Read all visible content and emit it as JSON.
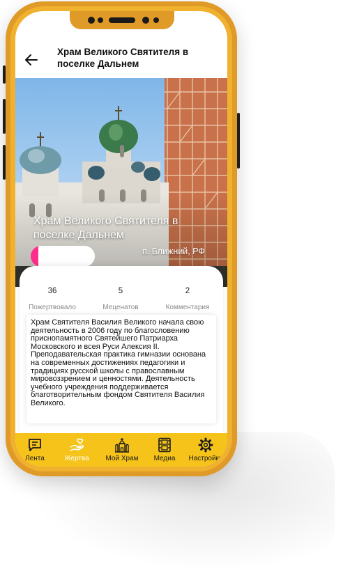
{
  "appbar": {
    "title": "Храм Великого Святителя в поселке Дальнем"
  },
  "hero": {
    "title": "Храм Великого Святителя в поселке Дальнем",
    "location": "п. Ближний, РФ",
    "progress_fraction": 0.12,
    "progress_color": "#ff2d8b"
  },
  "stats": [
    {
      "value": "36",
      "label": "Пожертвовало"
    },
    {
      "value": "5",
      "label": "Меценатов"
    },
    {
      "value": "2",
      "label": "Комментария"
    }
  ],
  "description": "Храм Святителя Василия Великого начала свою деятельность в 2006 году по благословению приснопамятного Святейшего Патриарха Московского и всея Руси Алексия II. Преподавательская практика гимназии основана на современных достижениях педагогики и традициях русской школы с православным мировоззрением и ценностями. Деятельность учебного учреждения поддерживается благотворительным фондом Святителя Василия Великого.",
  "tabs": [
    {
      "label": "Лента",
      "icon": "chat-icon"
    },
    {
      "label": "Жертва",
      "icon": "hand-heart-icon",
      "active": true
    },
    {
      "label": "Мой Храм",
      "icon": "church-icon"
    },
    {
      "label": "Медиа",
      "icon": "film-icon"
    },
    {
      "label": "Настройки",
      "icon": "gear-icon"
    }
  ],
  "colors": {
    "phone_frame": "#e09a28",
    "tabbar": "#f5c31a",
    "active_tab_label": "#ffffff"
  }
}
